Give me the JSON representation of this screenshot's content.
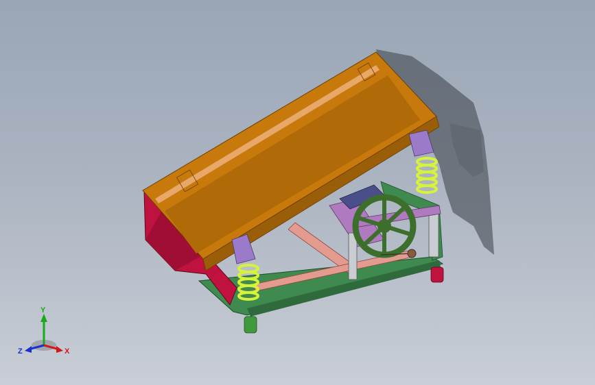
{
  "viewport": {
    "background_top": "#9aa6b6",
    "background_bottom": "#c9ced6"
  },
  "model": {
    "description_icon": "vibrating-screen-model",
    "colors": {
      "trough": "#c77a0b",
      "trough_dark": "#9a5d08",
      "trough_rim": "#e8a86a",
      "discharge_hood": "#c0123f",
      "springs": "#d6f23a",
      "spring_cups": "#9b7bc9",
      "frame_green": "#3f8a4e",
      "frame_pink": "#e39a8f",
      "flywheel": "#3c6e2c",
      "motor": "#4a4f8a",
      "feet_green": "#3f9a3b",
      "feet_red": "#c0123f"
    }
  },
  "triad": {
    "x_label": "X",
    "y_label": "Y",
    "z_label": "Z",
    "x_color": "#d01818",
    "y_color": "#18a818",
    "z_color": "#1830d0"
  }
}
